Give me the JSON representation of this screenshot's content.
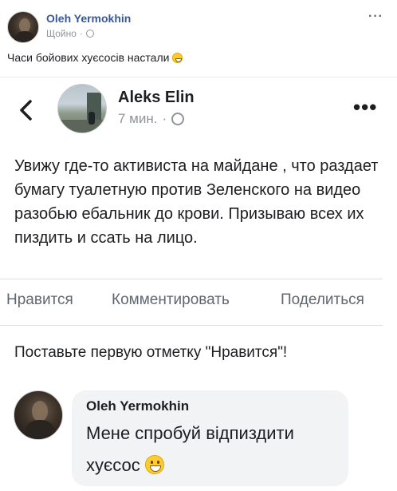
{
  "outer_post": {
    "author": "Oleh Yermokhin",
    "timestamp": "Щойно",
    "separator": "·",
    "privacy_icon": "globe-icon",
    "more_icon": "more-options-icon",
    "more_label": "···",
    "text": "Часи бойових хуєсосів настали",
    "text_emoji": "grinning-face-emoji"
  },
  "embedded_post": {
    "back_icon": "chevron-left-icon",
    "author": "Aleks Elin",
    "timestamp": "7 мин.",
    "separator": "·",
    "privacy_icon": "globe-icon",
    "more_label": "•••",
    "text": "Увижу где-то активиста на майдане , что раздает бумагу туалетную против Зеленского на видео разобью ебальник до крови. Призываю всех их пиздить и ссать на лицо.",
    "actions": {
      "like": "Нравится",
      "comment": "Комментировать",
      "share": "Поделиться"
    },
    "first_like_prompt": "Поставьте первую отметку \"Нравится\"!",
    "comment": {
      "author": "Oleh Yermokhin",
      "text": "Мене спробуй відпиздити хуєсос",
      "emoji": "grinning-face-emoji"
    }
  },
  "colors": {
    "link_name": "#365899",
    "meta_gray": "#90949c",
    "action_gray": "#606770",
    "bubble_bg": "#f2f3f5"
  }
}
